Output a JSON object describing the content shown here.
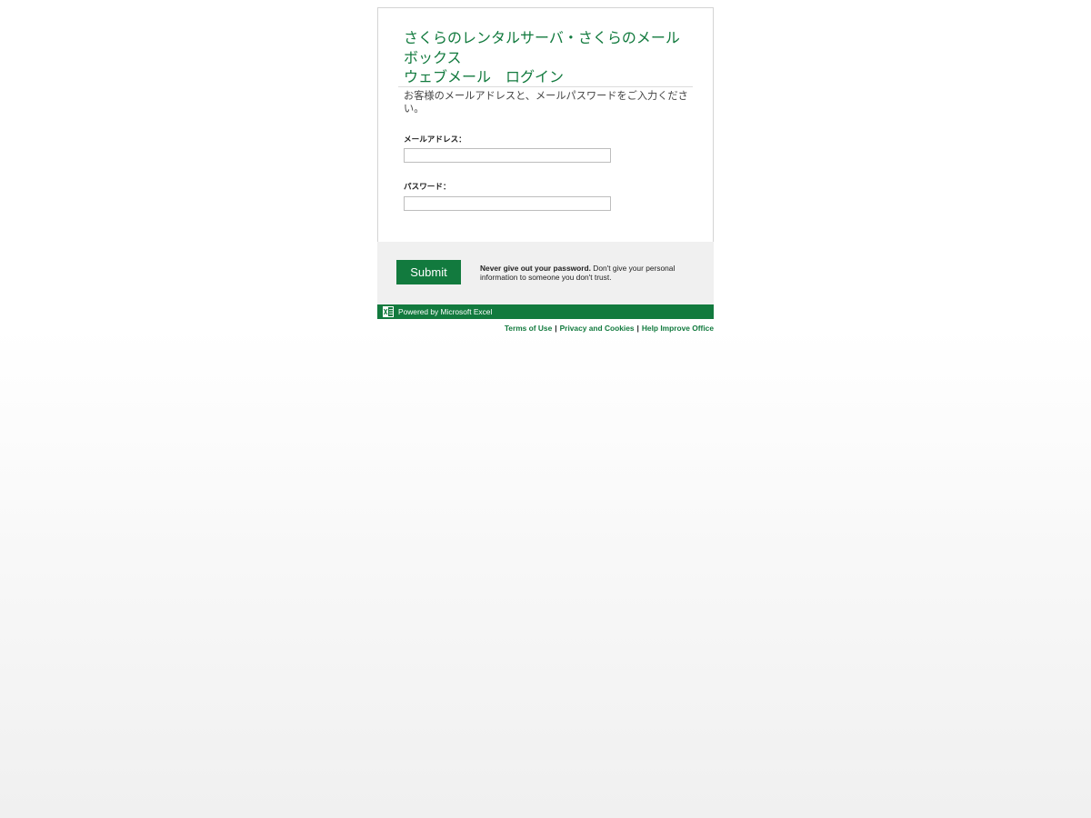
{
  "header": {
    "title_lines": [
      "さくらのレンタルサーバ・さくらのメール",
      "ボックス",
      "ウェブメール　ログイン"
    ],
    "instruction": "お客様のメールアドレスと、メールパスワードをご入力ください。"
  },
  "form": {
    "email_label": "メールアドレス：",
    "email_value": "",
    "password_label": "パスワード：",
    "password_value": "",
    "submit_label": "Submit"
  },
  "warning": {
    "bold": "Never give out your password.",
    "text": " Don't give your personal information to someone you don't trust."
  },
  "powered": {
    "icon": "excel-icon",
    "text": "Powered by Microsoft Excel"
  },
  "footer": {
    "links": [
      "Terms of Use",
      "Privacy and Cookies",
      "Help Improve Office"
    ],
    "separator": "|"
  },
  "colors": {
    "accent": "#127a3e",
    "bar_background": "#f0f0f0",
    "border": "#d4d4d4"
  }
}
